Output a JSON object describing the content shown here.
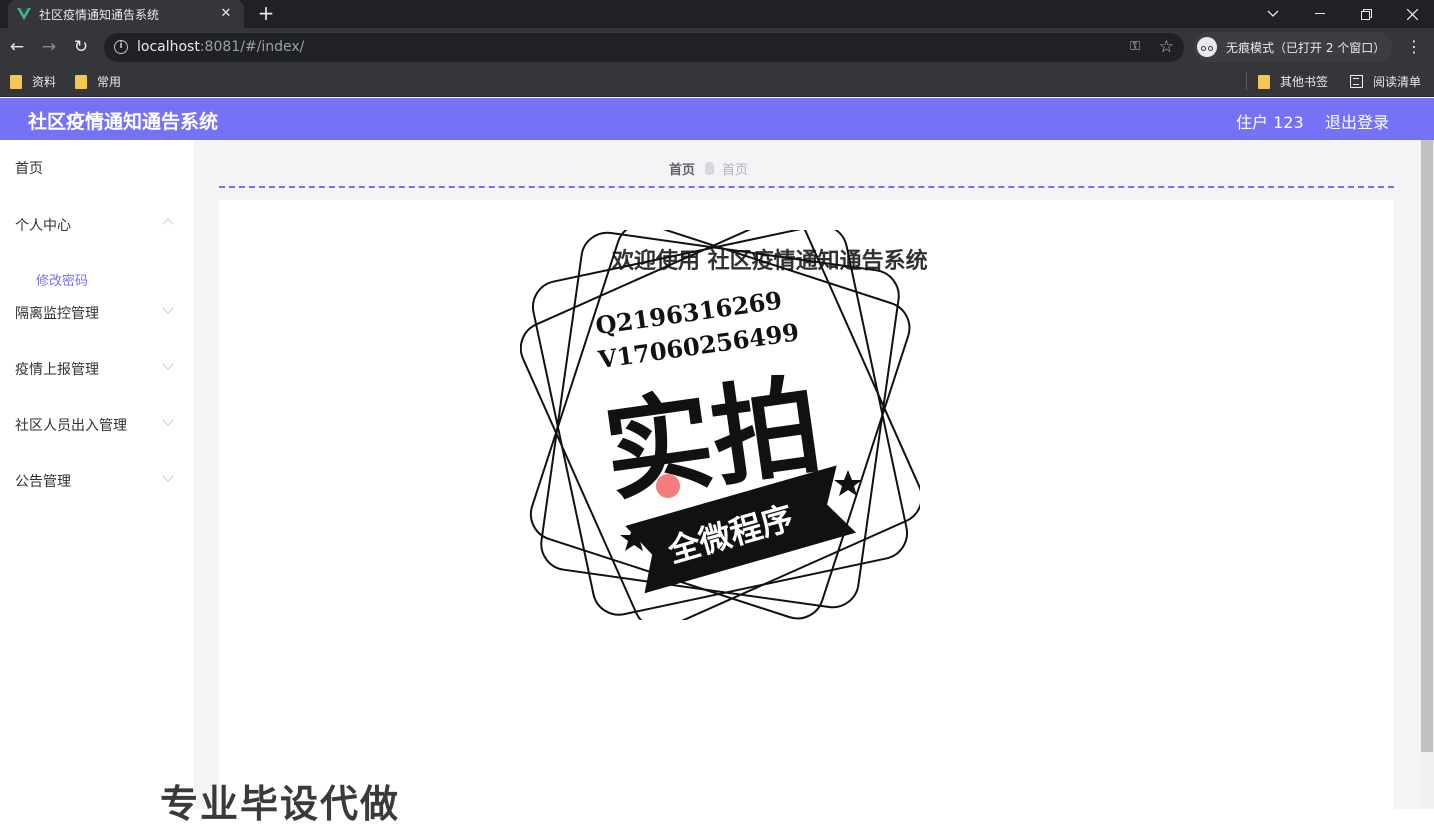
{
  "browser": {
    "tab_title": "社区疫情通知通告系统",
    "url_host": "localhost",
    "url_rest": ":8081/#/index/",
    "incognito_label": "无痕模式（已打开 2 个窗口）",
    "bookmarks": [
      "资料",
      "常用"
    ],
    "other_bookmarks": "其他书签",
    "reading_list": "阅读清单"
  },
  "header": {
    "title": "社区疫情通知通告系统",
    "user": "住户 123",
    "logout": "退出登录"
  },
  "sidebar": {
    "items": [
      {
        "label": "首页"
      },
      {
        "label": "个人中心",
        "sub": [
          "修改密码"
        ]
      },
      {
        "label": "隔离监控管理"
      },
      {
        "label": "疫情上报管理"
      },
      {
        "label": "社区人员出入管理"
      },
      {
        "label": "公告管理"
      }
    ]
  },
  "breadcrumb": {
    "home": "首页",
    "current": "首页"
  },
  "main": {
    "welcome": "欢迎使用 社区疫情通知通告系统"
  },
  "watermark": {
    "line1": "Q2196316269",
    "line2": "V17060256499",
    "big": "实拍",
    "banner": "全微程序",
    "bottom": "专业毕设代做"
  },
  "colors": {
    "accent": "#7572f7",
    "chrome_dark": "#202124",
    "chrome_mid": "#35363a"
  }
}
